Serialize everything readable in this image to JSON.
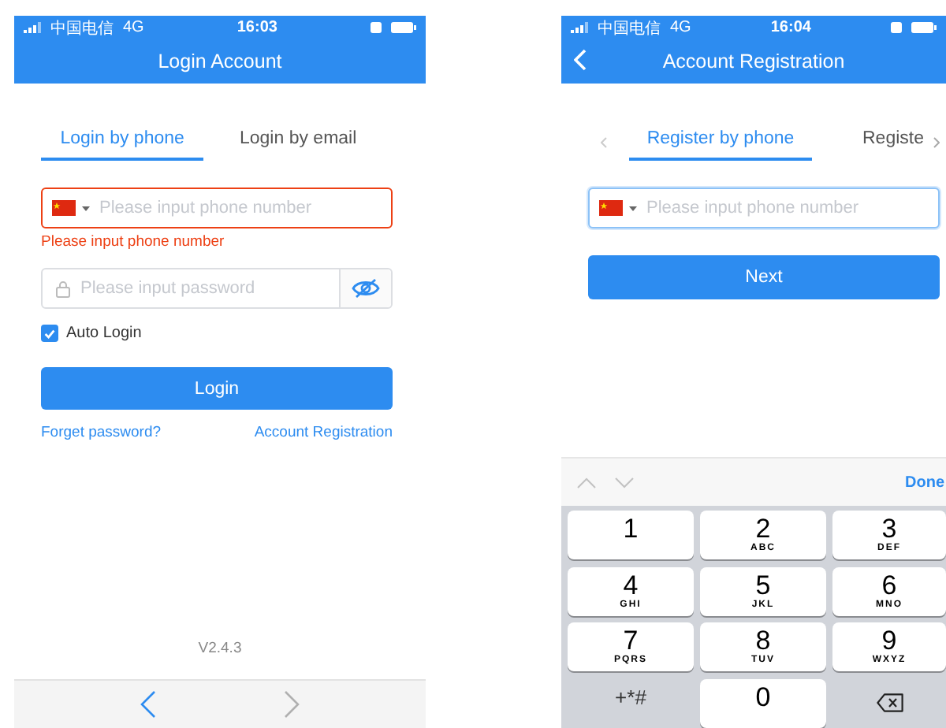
{
  "login": {
    "status_bar": {
      "carrier": "中国电信",
      "network": "4G",
      "time": "16:03"
    },
    "title": "Login Account",
    "tabs": [
      {
        "label": "Login by phone",
        "selected": true
      },
      {
        "label": "Login by email",
        "selected": false
      }
    ],
    "phone_field": {
      "placeholder": "Please input phone number",
      "error": true
    },
    "error_message": "Please input phone number",
    "password_field": {
      "placeholder": "Please input password"
    },
    "auto_login": {
      "label": "Auto Login",
      "checked": true
    },
    "login_button": "Login",
    "links": [
      "Forget password?",
      "Account Registration"
    ],
    "version": "V2.4.3",
    "browser_nav": {
      "back_disabled": false,
      "forward_disabled": true
    }
  },
  "registration": {
    "status_bar": {
      "carrier": "中国电信",
      "network": "4G",
      "time": "16:04"
    },
    "title": "Account Registration",
    "tabs": [
      {
        "label": "Register by phone",
        "selected": true
      },
      {
        "label": "Registe",
        "selected": false
      }
    ],
    "phone_field": {
      "placeholder": "Please input phone number",
      "focused": true
    },
    "next_button": "Next",
    "keyboard": {
      "done": "Done",
      "keys": [
        {
          "kind": "digit",
          "digit": "1"
        },
        {
          "kind": "digit",
          "digit": "2",
          "letters": "ABC"
        },
        {
          "kind": "digit",
          "digit": "3",
          "letters": "DEF"
        },
        {
          "kind": "digit",
          "digit": "4",
          "letters": "GHI"
        },
        {
          "kind": "digit",
          "digit": "5",
          "letters": "JKL"
        },
        {
          "kind": "digit",
          "digit": "6",
          "letters": "MNO"
        },
        {
          "kind": "digit",
          "digit": "7",
          "letters": "PQRS"
        },
        {
          "kind": "digit",
          "digit": "8",
          "letters": "TUV"
        },
        {
          "kind": "digit",
          "digit": "9",
          "letters": "WXYZ"
        },
        {
          "kind": "symbols",
          "label": "+*#"
        },
        {
          "kind": "digit",
          "digit": "0"
        },
        {
          "kind": "backspace"
        }
      ]
    }
  }
}
